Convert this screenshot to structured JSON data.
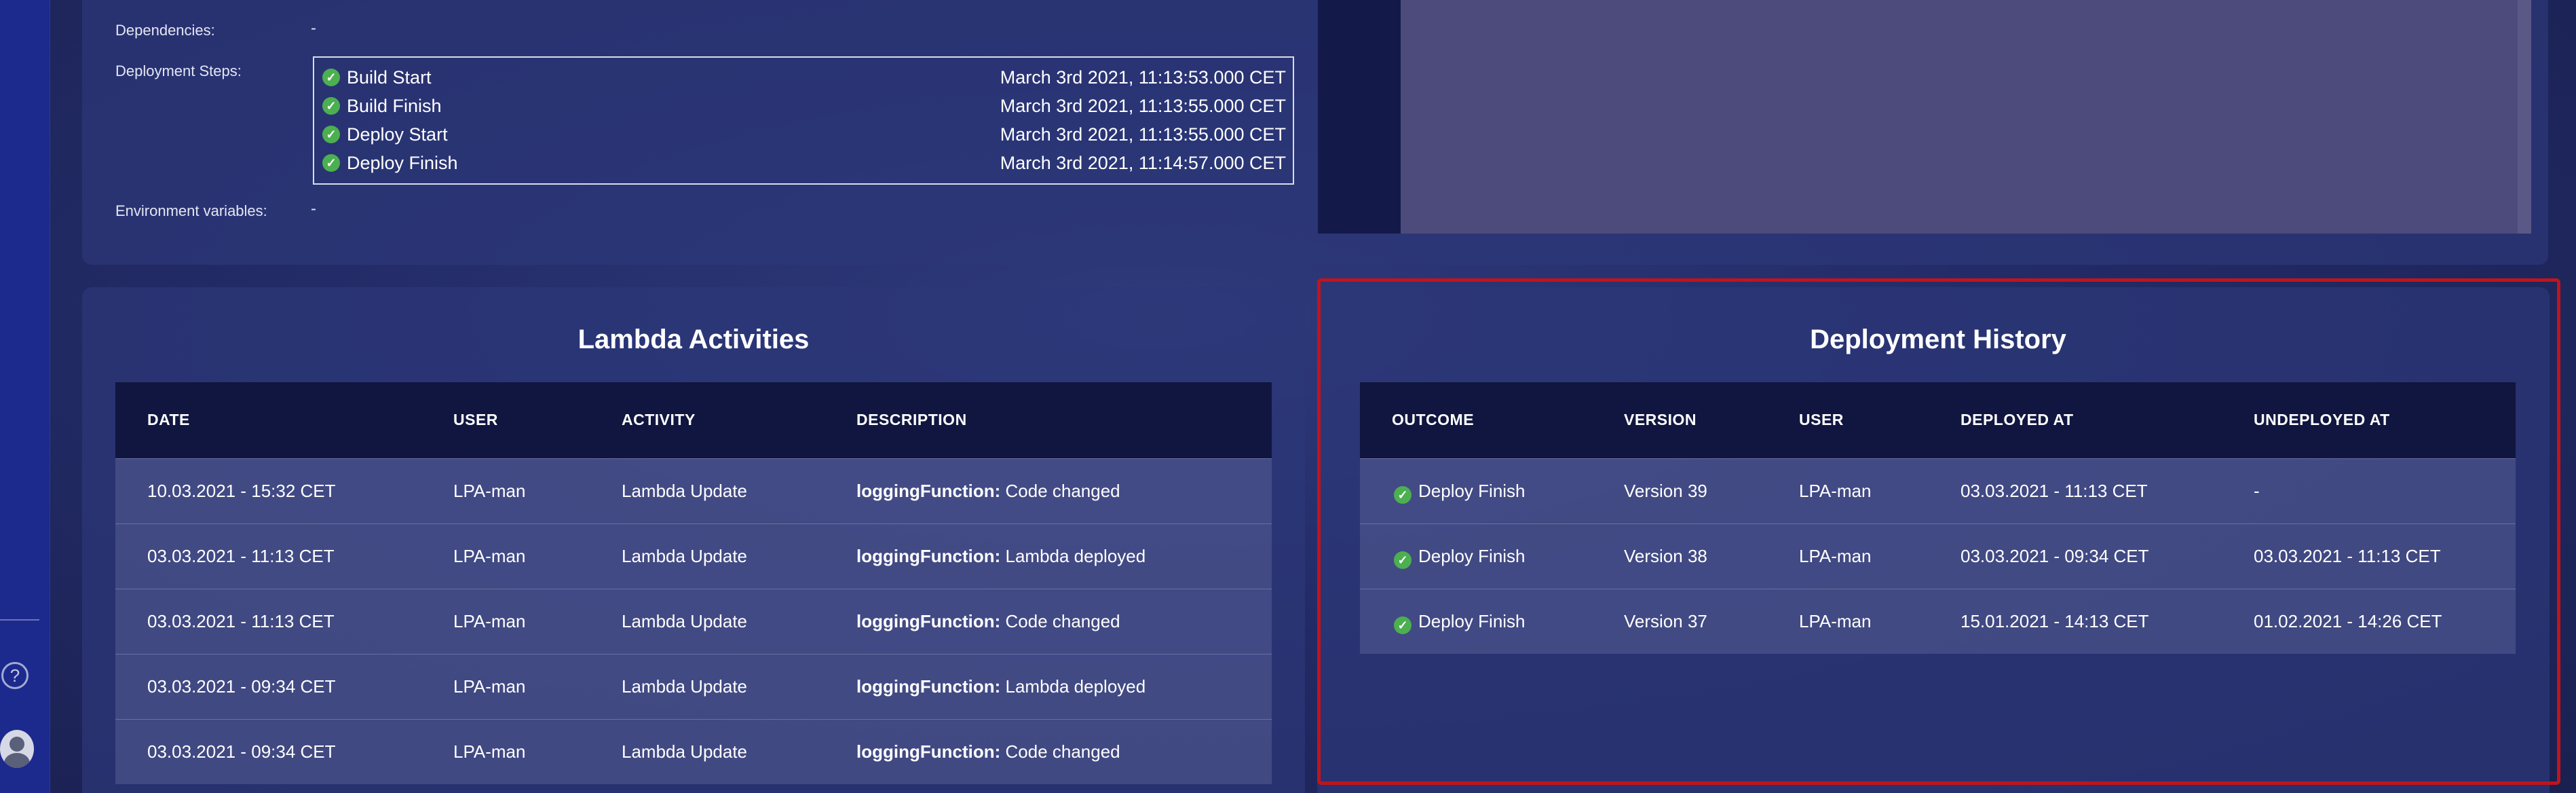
{
  "details": {
    "dependencies_label": "Dependencies:",
    "dependencies_value": "-",
    "steps_label": "Deployment Steps:",
    "env_label": "Environment variables:",
    "env_value": "-",
    "steps": [
      {
        "name": "Build Start",
        "time": "March 3rd 2021, 11:13:53.000 CET"
      },
      {
        "name": "Build Finish",
        "time": "March 3rd 2021, 11:13:55.000 CET"
      },
      {
        "name": "Deploy Start",
        "time": "March 3rd 2021, 11:13:55.000 CET"
      },
      {
        "name": "Deploy Finish",
        "time": "March 3rd 2021, 11:14:57.000 CET"
      }
    ]
  },
  "lambda_activities": {
    "title": "Lambda Activities",
    "columns": [
      "DATE",
      "USER",
      "ACTIVITY",
      "DESCRIPTION"
    ],
    "rows": [
      {
        "date": "10.03.2021 - 15:32 CET",
        "user": "LPA-man",
        "activity": "Lambda Update",
        "fn": "loggingFunction:",
        "desc": "Code changed"
      },
      {
        "date": "03.03.2021 - 11:13 CET",
        "user": "LPA-man",
        "activity": "Lambda Update",
        "fn": "loggingFunction:",
        "desc": "Lambda deployed"
      },
      {
        "date": "03.03.2021 - 11:13 CET",
        "user": "LPA-man",
        "activity": "Lambda Update",
        "fn": "loggingFunction:",
        "desc": "Code changed"
      },
      {
        "date": "03.03.2021 - 09:34 CET",
        "user": "LPA-man",
        "activity": "Lambda Update",
        "fn": "loggingFunction:",
        "desc": "Lambda deployed"
      },
      {
        "date": "03.03.2021 - 09:34 CET",
        "user": "LPA-man",
        "activity": "Lambda Update",
        "fn": "loggingFunction:",
        "desc": "Code changed"
      }
    ]
  },
  "deployment_history": {
    "title": "Deployment History",
    "columns": [
      "OUTCOME",
      "VERSION",
      "USER",
      "DEPLOYED AT",
      "UNDEPLOYED AT"
    ],
    "rows": [
      {
        "outcome": "Deploy Finish",
        "version": "Version 39",
        "user": "LPA-man",
        "deployed": "03.03.2021 - 11:13 CET",
        "undeployed": "-"
      },
      {
        "outcome": "Deploy Finish",
        "version": "Version 38",
        "user": "LPA-man",
        "deployed": "03.03.2021 - 09:34 CET",
        "undeployed": "03.03.2021 - 11:13 CET"
      },
      {
        "outcome": "Deploy Finish",
        "version": "Version 37",
        "user": "LPA-man",
        "deployed": "15.01.2021 - 14:13 CET",
        "undeployed": "01.02.2021 - 14:26 CET"
      }
    ]
  },
  "sidebar": {
    "help_glyph": "?",
    "help_icon": "help-icon",
    "avatar_icon": "user-avatar-icon"
  },
  "colors": {
    "success": "#4caf50",
    "highlight": "#c0141c",
    "header_bg": "#10163f"
  }
}
